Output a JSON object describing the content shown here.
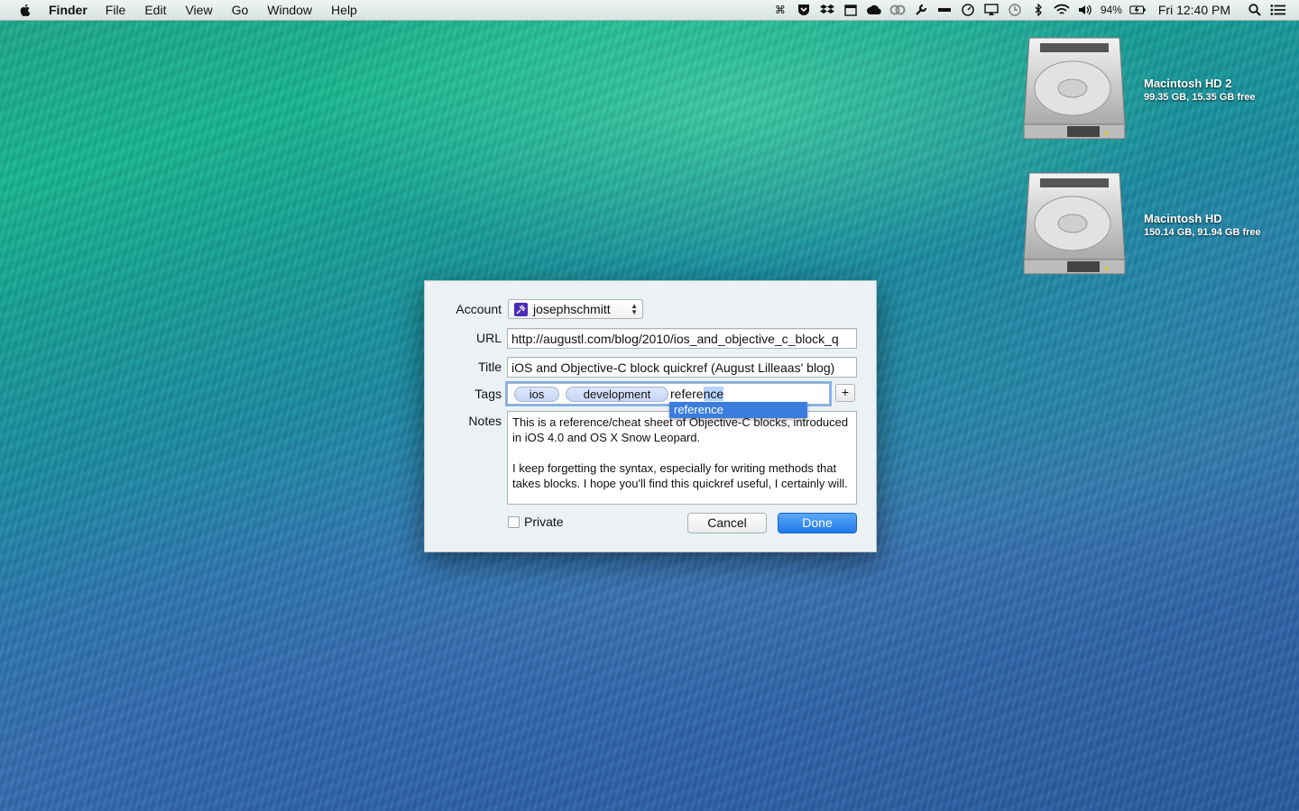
{
  "menubar": {
    "app_name": "Finder",
    "menus": [
      "File",
      "Edit",
      "View",
      "Go",
      "Window",
      "Help"
    ],
    "battery": "94%",
    "clock": "Fri 12:40 PM"
  },
  "desktop": {
    "drives": [
      {
        "name": "Macintosh HD 2",
        "info": "99.35 GB, 15.35 GB free"
      },
      {
        "name": "Macintosh HD",
        "info": "150.14 GB, 91.94 GB free"
      }
    ]
  },
  "dialog": {
    "account_label": "Account",
    "account_value": "josephschmitt",
    "url_label": "URL",
    "url_value": "http://augustl.com/blog/2010/ios_and_objective_c_block_q",
    "title_label": "Title",
    "title_value": "iOS and Objective-C block quickref (August Lilleaas' blog)",
    "tags_label": "Tags",
    "tags": [
      "ios",
      "development"
    ],
    "typed_tag_plain": "refere",
    "typed_tag_selected": "nce",
    "suggestion": "reference",
    "add_label": "+",
    "notes_label": "Notes",
    "notes_paragraphs": [
      "This is a reference/cheat sheet of Objective-C blocks, introduced in iOS 4.0 and OS X Snow Leopard.",
      "I keep forgetting the syntax, especially for writing methods that takes blocks. I hope you'll find this quickref useful, I certainly will."
    ],
    "private_label": "Private",
    "cancel_label": "Cancel",
    "done_label": "Done"
  }
}
